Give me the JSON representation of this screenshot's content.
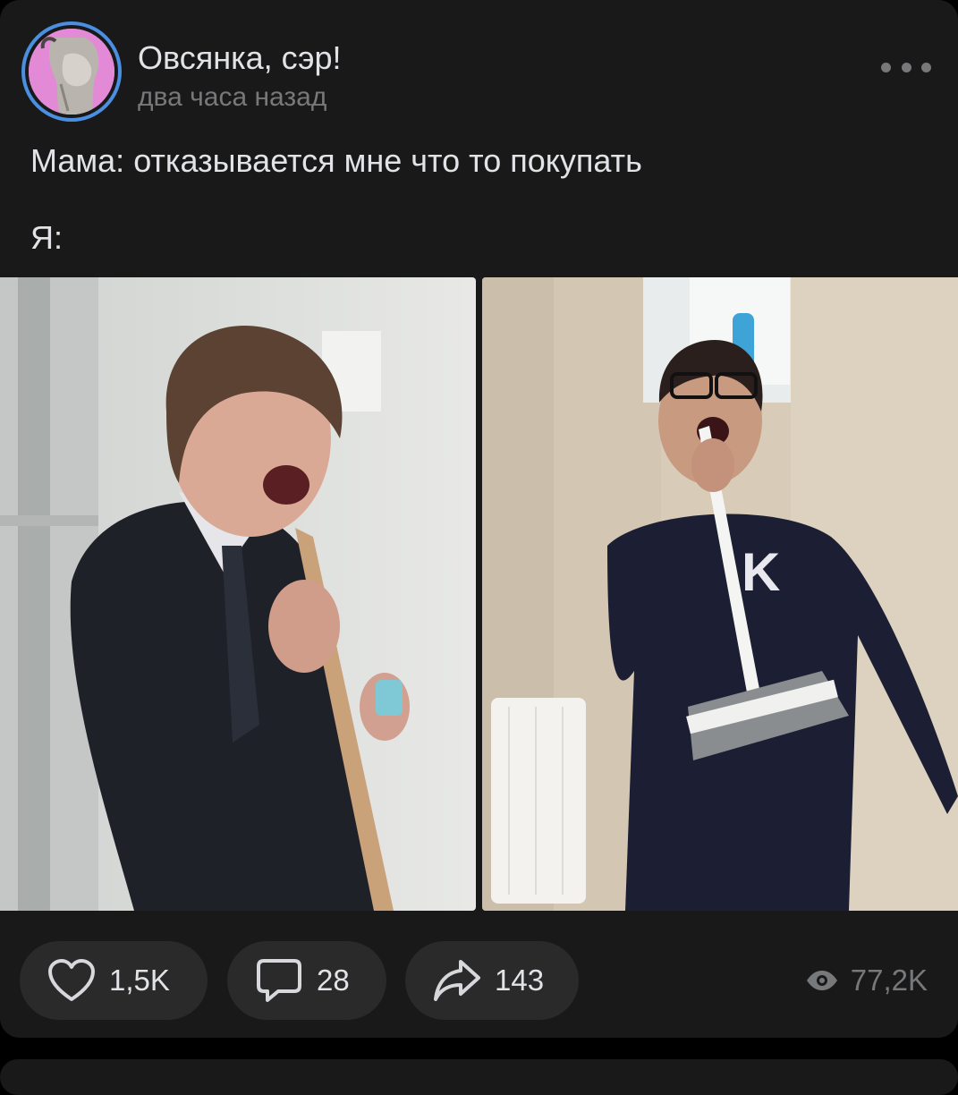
{
  "post": {
    "author": "Овсянка, сэр!",
    "time": "два часа назад",
    "text_line1": "Мама: отказывается мне что то покупать",
    "text_line2": "Я:"
  },
  "icons": {
    "more": "more-horizontal-icon",
    "like": "heart-icon",
    "comment": "comment-icon",
    "share": "share-arrow-icon",
    "views": "eye-icon"
  },
  "actions": {
    "likes": "1,5K",
    "comments": "28",
    "shares": "143",
    "views": "77,2K"
  },
  "colors": {
    "background": "#000000",
    "card": "#19191a",
    "pill": "#2a2a2b",
    "text_primary": "#e1e3e6",
    "text_secondary": "#76787a",
    "avatar_ring": "#4a8fe0",
    "avatar_bg": "#e28ad6"
  }
}
